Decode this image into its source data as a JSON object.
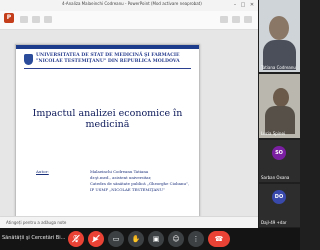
{
  "window": {
    "title": "4-Analiza Malaeinchi Codreanu - PowerPoint (Mod activare neaprobat)"
  },
  "slide": {
    "university_line1": "UNIVERSITATEA DE STAT DE MEDICINĂ ŞI FARMACIE",
    "university_line2": "\"NICOLAE TESTEMIŢANU\" DIN REPUBLICA MOLDOVA",
    "title": "Impactul analizei economice în medicină",
    "author_label": "Autor:",
    "author_lines": [
      "Malaeinchi Codreanu Tatiana",
      "dr.şt.med., asistent universitar,",
      "Catedra de sănătate publică „Gheorghe Ciobanu”,",
      "IP USMF „NICOLAE TESTEMIŢANU”"
    ]
  },
  "statusbar": {
    "text": "Atingeți pentru a adăuga note"
  },
  "participants": [
    {
      "name": "Tatiana Codreanu"
    },
    {
      "name": "Lucia Spinei"
    },
    {
      "name": "Sarban Oxana",
      "initials": "SO",
      "color": "#7b1fa2"
    },
    {
      "name": "Dajl-49 +dar",
      "initials": "DO",
      "color": "#3949ab"
    }
  ],
  "controls": {
    "meeting_name": "Sănătății şi Cercetări Bi...",
    "buttons": [
      "mic-off",
      "camera-off",
      "captions",
      "raise-hand",
      "present",
      "emoji",
      "more",
      "leave-call"
    ]
  }
}
